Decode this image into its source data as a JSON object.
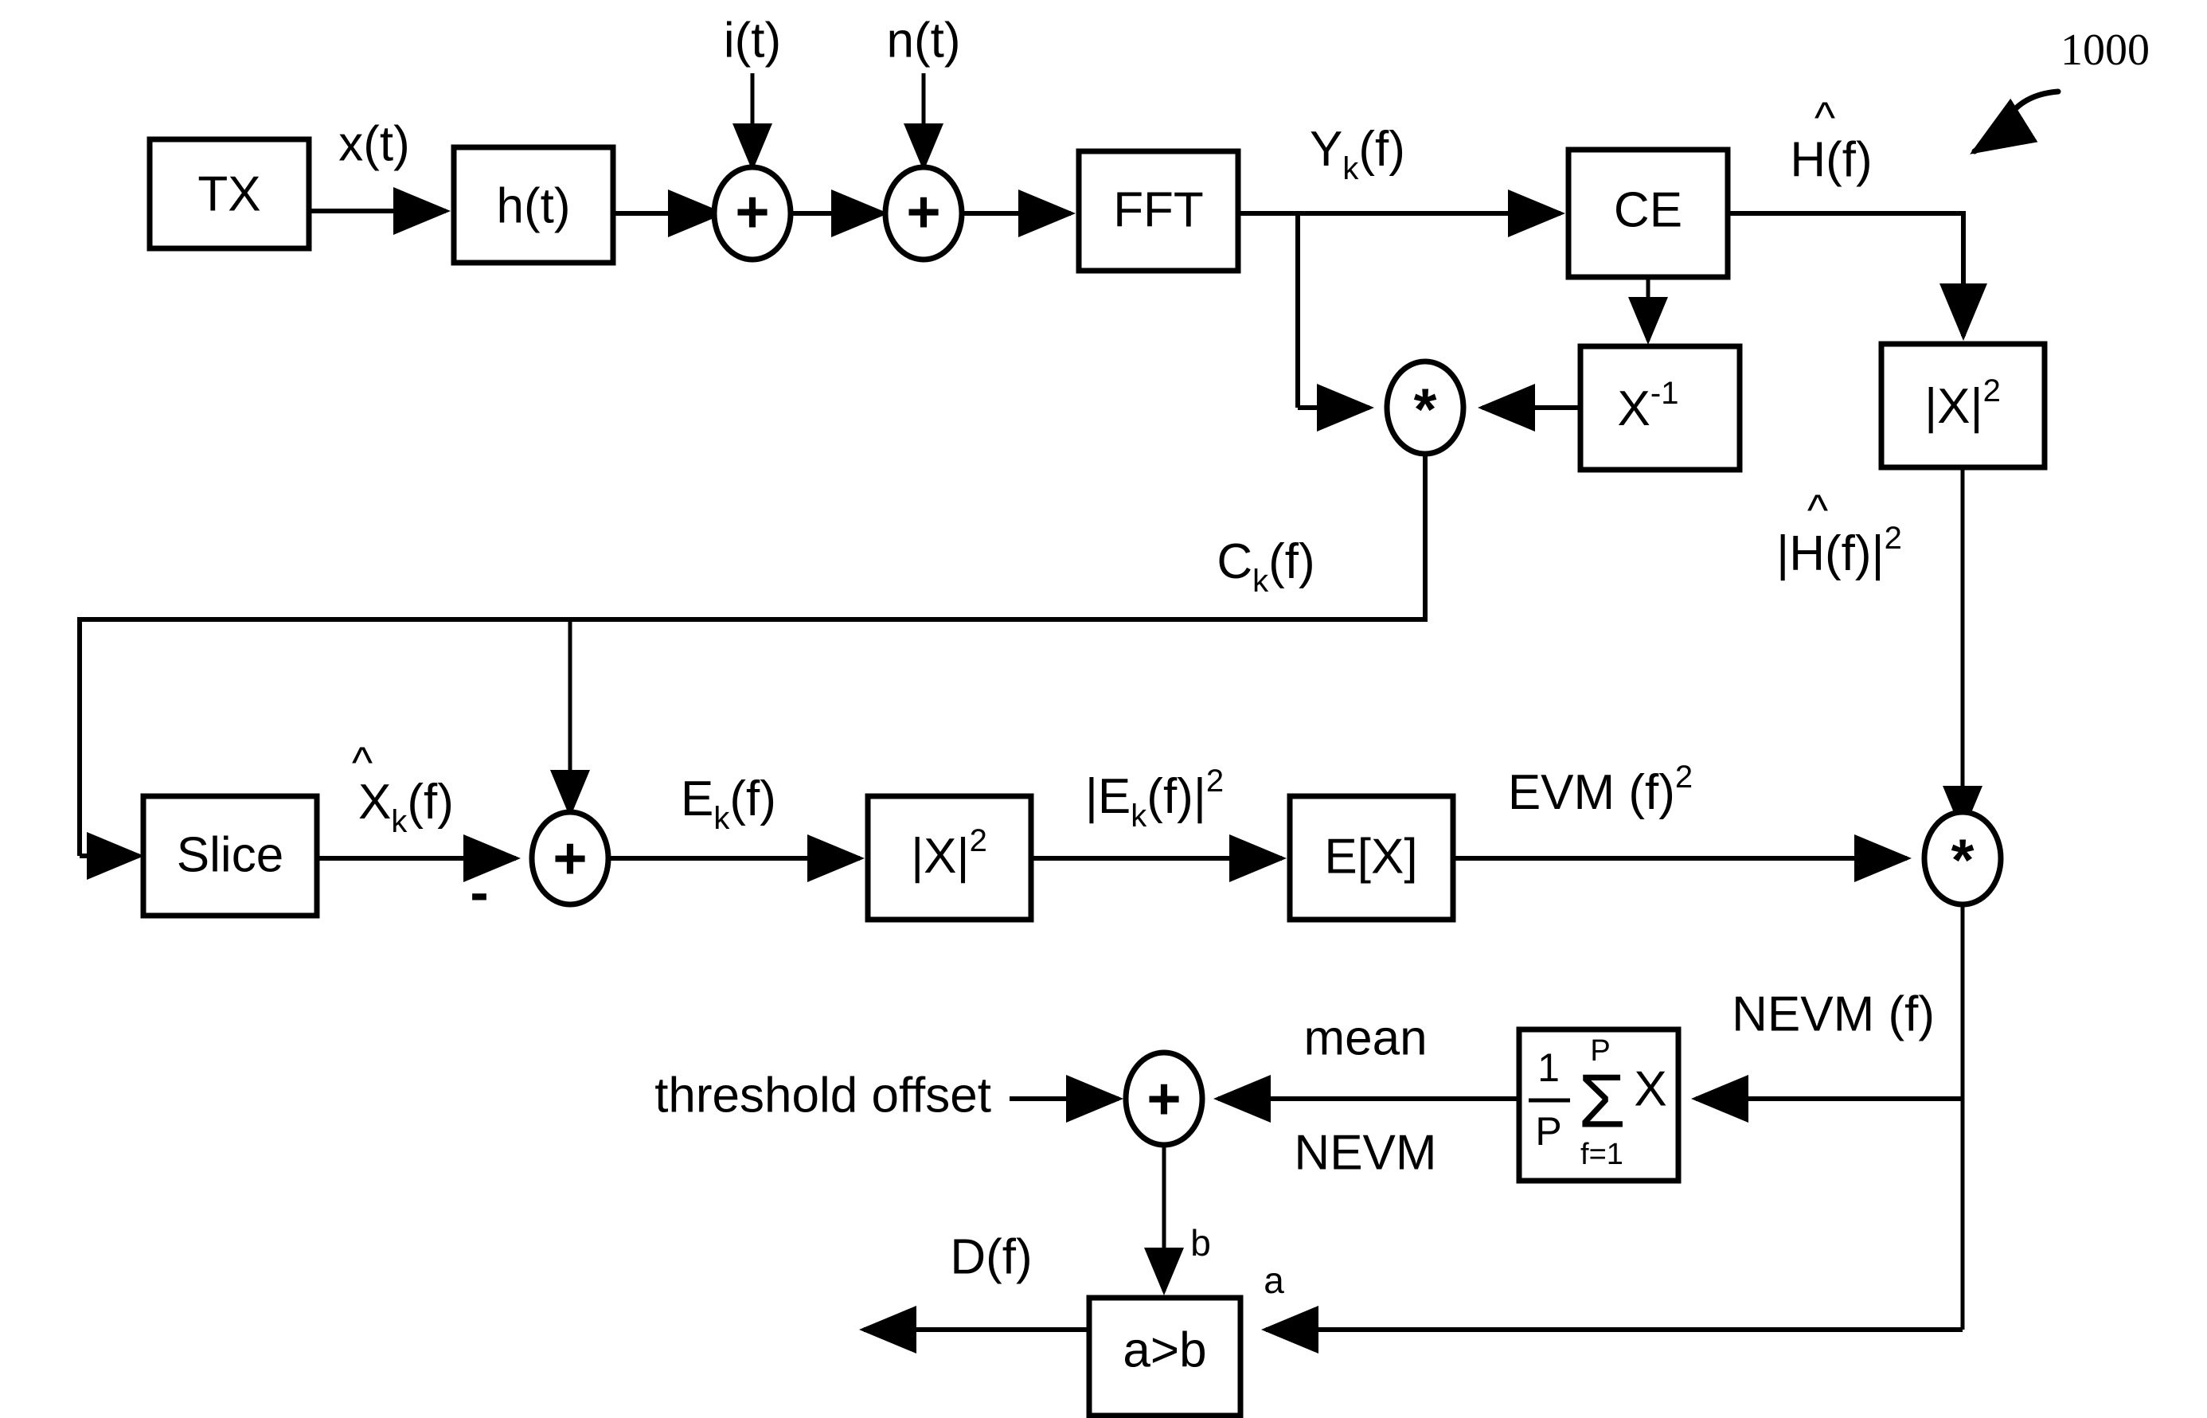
{
  "figure": {
    "reference_numeral": "1000",
    "background_color": "#ffffff",
    "line_color": "#000000"
  },
  "blocks": {
    "tx": "TX",
    "channel": "h(t)",
    "fft": "FFT",
    "ce": "CE",
    "x_inverse": "X",
    "x_inverse_exp": "-1",
    "mag_sq_top": "|X|",
    "mag_sq_top_exp": "2",
    "slice": "Slice",
    "mag_sq_mid": "|X|",
    "mag_sq_mid_exp": "2",
    "expectation": "E[X]",
    "mean_numerator": "1",
    "mean_denominator": "P",
    "mean_sigma": "Σ",
    "mean_upper_limit": "P",
    "mean_lower_limit": "f=1",
    "mean_operand": "X",
    "comparator": "a>b"
  },
  "operators": {
    "adder1": "+",
    "adder2": "+",
    "multiplier_top": "*",
    "adder_error": "+",
    "multiplier_right": "*",
    "adder_threshold": "+",
    "minus_sign": "-"
  },
  "signals": {
    "interference": "i(t)",
    "noise": "n(t)",
    "tx_out": "x(t)",
    "fft_out_base": "Y",
    "fft_out_sub": "k",
    "fft_out_tail": "(f)",
    "ce_out_base": "H(f)",
    "ce_out_hat": "^",
    "mult_top_out_base": "C",
    "mult_top_out_sub": "k",
    "mult_top_out_tail": "(f)",
    "h_mag_sq": "|H(f)|",
    "h_mag_sq_exp": "2",
    "h_mag_sq_hat": "^",
    "slice_out_base": "X",
    "slice_out_sub": "k",
    "slice_out_tail": "(f)",
    "slice_out_hat": "^",
    "error_base": "E",
    "error_sub": "k",
    "error_tail": "(f)",
    "error_mag_sq": "|E",
    "error_mag_sq_sub": "k",
    "error_mag_sq_tail": "(f)|",
    "error_mag_sq_exp": "2",
    "evm": "EVM (f)",
    "evm_exp": "2",
    "nevm": "NEVM (f)",
    "mean_nevm_line1": "mean",
    "mean_nevm_line2": "NEVM",
    "threshold_offset": "threshold offset",
    "comparator_input_b": "b",
    "comparator_input_a": "a",
    "decision_out": "D(f)"
  }
}
